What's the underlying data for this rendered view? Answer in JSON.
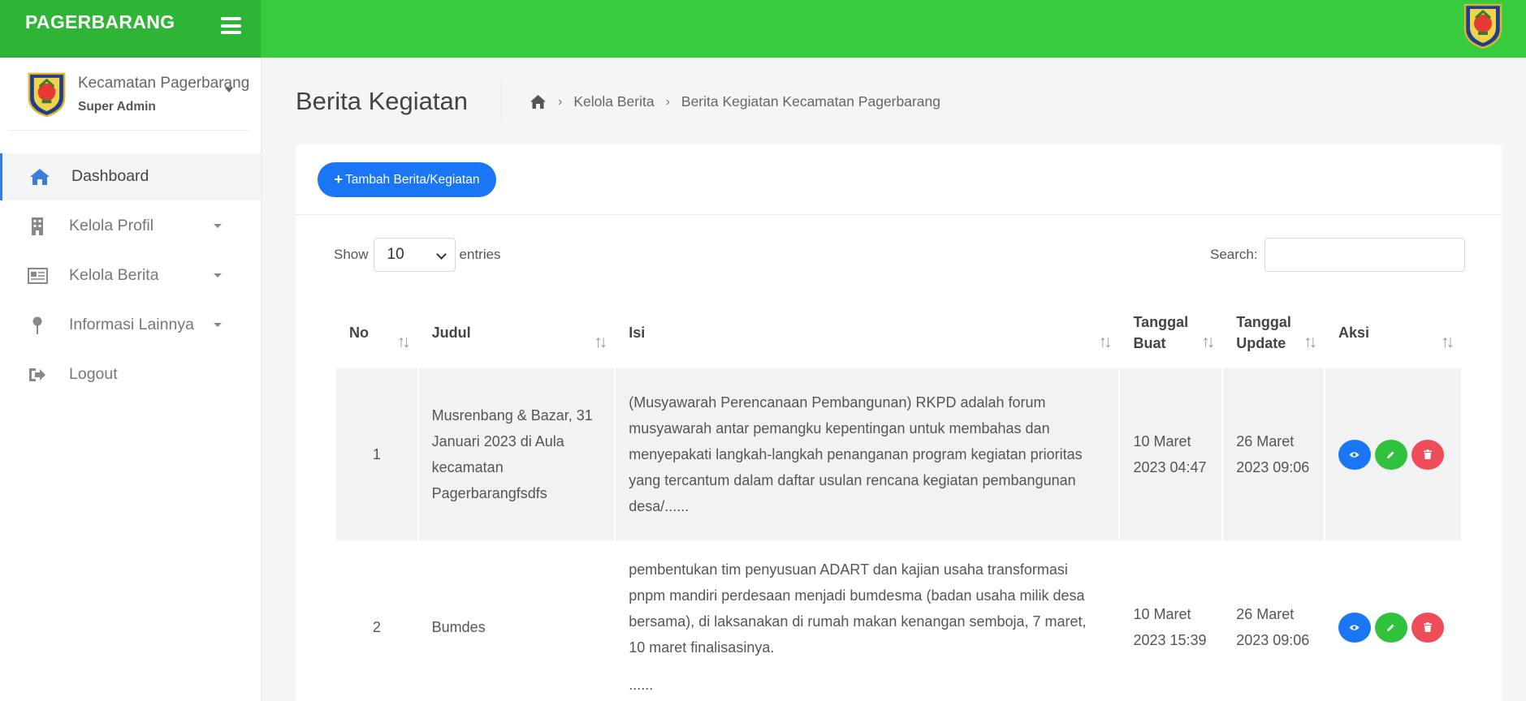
{
  "brand": {
    "title": "PAGERBARANG"
  },
  "user": {
    "name": "Kecamatan Pagerbarang",
    "role": "Super Admin"
  },
  "sidebar": {
    "items": [
      {
        "label": "Dashboard",
        "icon": "home-icon"
      },
      {
        "label": "Kelola Profil",
        "icon": "building-icon"
      },
      {
        "label": "Kelola Berita",
        "icon": "newspaper-icon"
      },
      {
        "label": "Informasi Lainnya",
        "icon": "map-pin-icon"
      },
      {
        "label": "Logout",
        "icon": "sign-out-icon"
      }
    ]
  },
  "page": {
    "title": "Berita Kegiatan"
  },
  "breadcrumb": {
    "sep": "›",
    "items": [
      "Kelola Berita",
      "Berita Kegiatan Kecamatan Pagerbarang"
    ]
  },
  "toolbar": {
    "add_plus": "+",
    "add_label": "Tambah Berita/Kegiatan"
  },
  "length": {
    "show": "Show",
    "value": "10",
    "entries": "entries"
  },
  "search": {
    "label": "Search:",
    "value": ""
  },
  "table": {
    "sort_glyph": "↑↓",
    "headers": [
      "No",
      "Judul",
      "Isi",
      "Tanggal Buat",
      "Tanggal Update",
      "Aksi"
    ],
    "rows": [
      {
        "no": "1",
        "judul": "Musrenbang & Bazar, 31 Januari 2023 di Aula kecamatan Pagerbarangfsdfs",
        "isi": "(Musyawarah Perencanaan Pembangunan) RKPD adalah forum musyawarah antar pemangku kepentingan untuk membahas dan menyepakati langkah-langkah penanganan program kegiatan prioritas yang tercantum dalam daftar usulan rencana kegiatan pembangunan desa/......",
        "isi_more": "",
        "created": "10 Maret 2023 04:47",
        "updated": "26 Maret 2023 09:06"
      },
      {
        "no": "2",
        "judul": "Bumdes",
        "isi": "pembentukan tim penyusuan ADART dan kajian usaha transformasi pnpm mandiri perdesaan menjadi bumdesma (badan usaha milik desa bersama), di laksanakan di rumah makan kenangan semboja, 7 maret, 10 maret finalisasinya.",
        "isi_more": "......",
        "created": "10 Maret 2023 15:39",
        "updated": "26 Maret 2023 09:06"
      }
    ]
  },
  "colors": {
    "topbar": "#36cc3e",
    "brand": "#2eb535",
    "primary": "#1a76f5",
    "success": "#30c23c",
    "danger": "#ef4c5a"
  }
}
